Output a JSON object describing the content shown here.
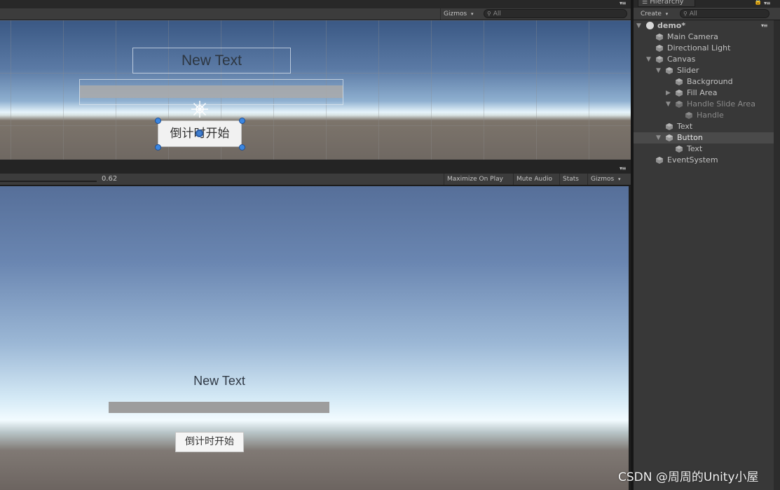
{
  "scene": {
    "menu_glyph": "▾≡",
    "gizmos_label": "Gizmos",
    "dropdown_glyph": "▾",
    "search_placeholder": "All",
    "text_label": "New Text",
    "button_label": "倒计时开始"
  },
  "game": {
    "menu_glyph": "▾≡",
    "scale_value": "0.62",
    "maximize_label": "Maximize On Play",
    "mute_label": "Mute Audio",
    "stats_label": "Stats",
    "gizmos_label": "Gizmos",
    "dropdown_glyph": "▾",
    "text_label": "New Text",
    "button_label": "倒计时开始"
  },
  "hierarchy": {
    "tab_label": "Hierarchy",
    "create_label": "Create",
    "create_glyph": "▾",
    "search_placeholder": "All",
    "menu_glyph": "▾≡",
    "scene_name": "demo*",
    "items": [
      {
        "label": "Main Camera"
      },
      {
        "label": "Directional Light"
      },
      {
        "label": "Canvas"
      },
      {
        "label": "Slider"
      },
      {
        "label": "Background"
      },
      {
        "label": "Fill Area"
      },
      {
        "label": "Handle Slide Area"
      },
      {
        "label": "Handle"
      },
      {
        "label": "Text"
      },
      {
        "label": "Button"
      },
      {
        "label": "Text"
      },
      {
        "label": "EventSystem"
      }
    ]
  },
  "watermark": "CSDN @周周的Unity小屋",
  "colors": {
    "selection": "#4a4a4a",
    "handle_blue": "#3b86e0"
  }
}
